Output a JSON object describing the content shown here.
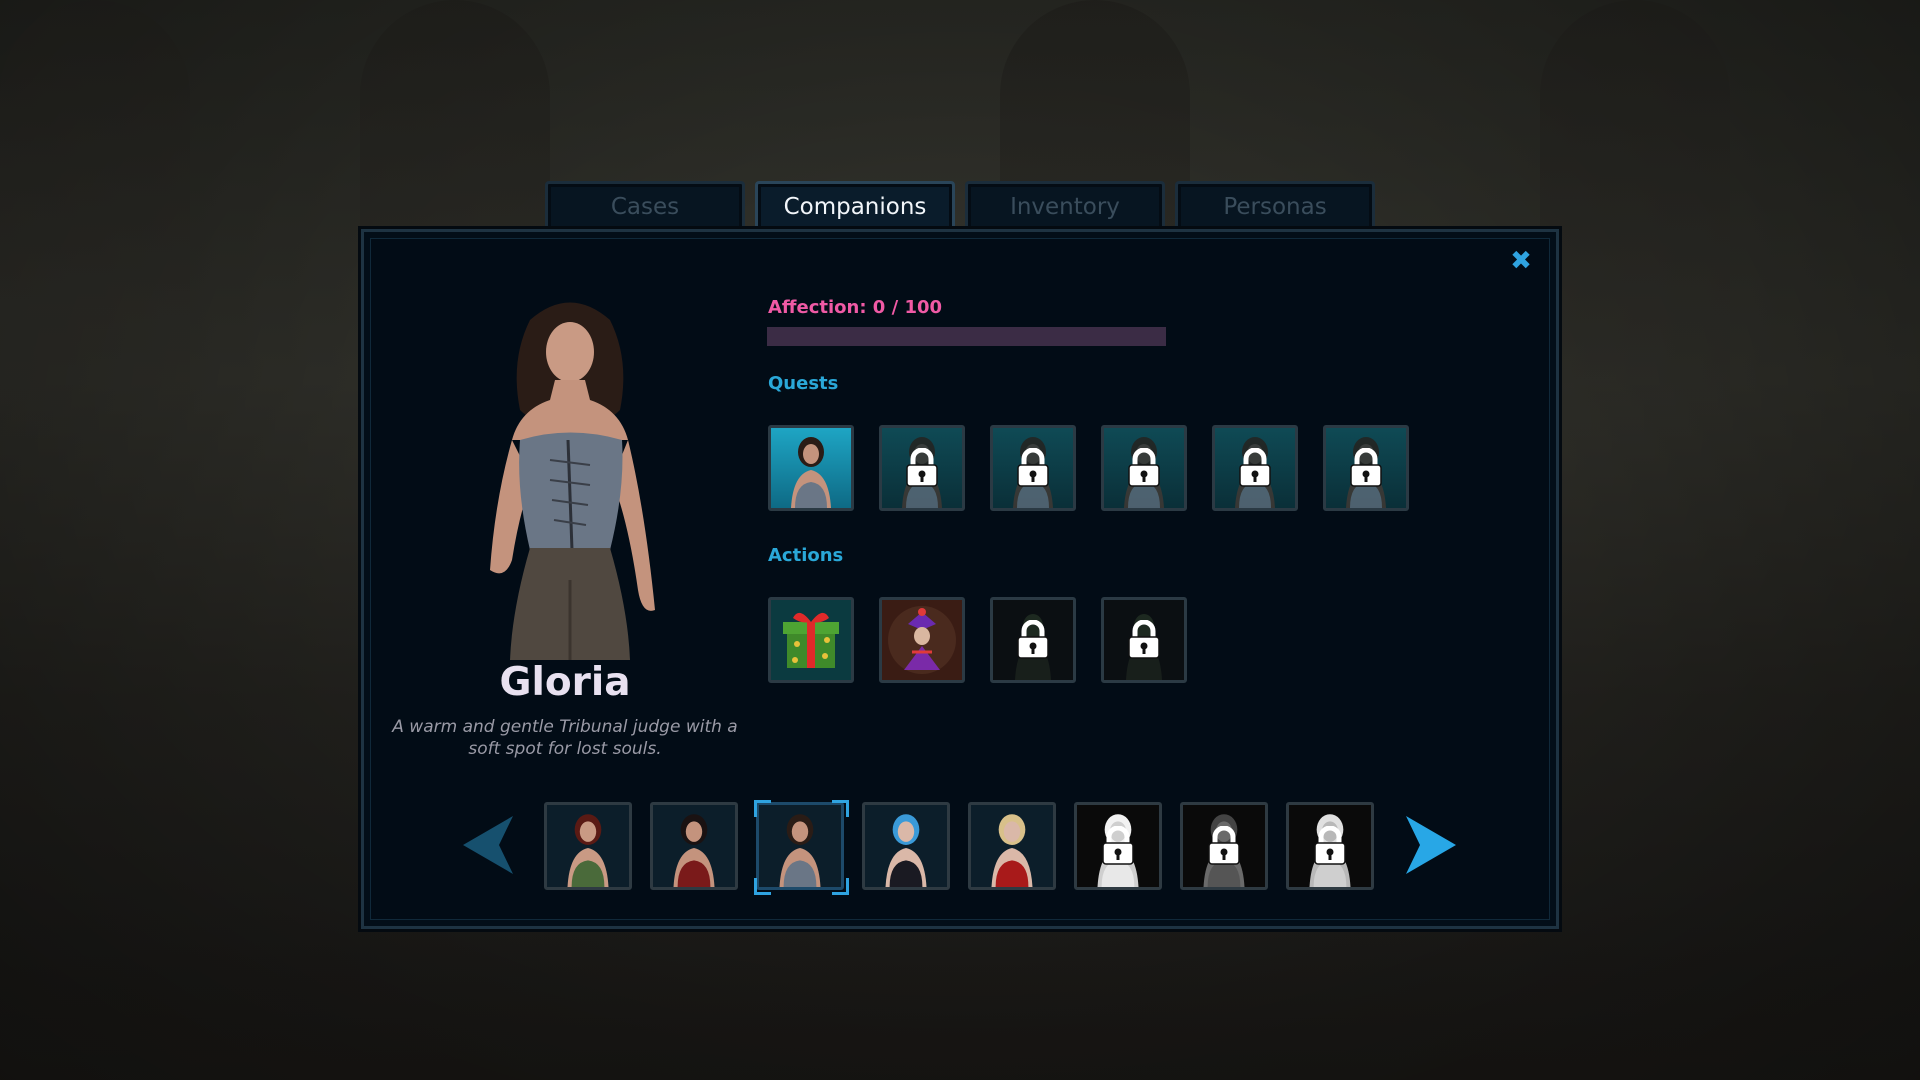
{
  "tabs": [
    {
      "label": "Cases",
      "active": false
    },
    {
      "label": "Companions",
      "active": true
    },
    {
      "label": "Inventory",
      "active": false
    },
    {
      "label": "Personas",
      "active": false
    }
  ],
  "close_icon": "close-icon",
  "character": {
    "name": "Gloria",
    "description": "A warm and gentle Tribunal judge with a soft spot for lost souls."
  },
  "affection": {
    "label": "Affection: 0 / 100",
    "value": 0,
    "max": 100,
    "color": "#f05aa5"
  },
  "quests": {
    "label": "Quests",
    "slots": [
      {
        "locked": false
      },
      {
        "locked": true
      },
      {
        "locked": true
      },
      {
        "locked": true
      },
      {
        "locked": true
      },
      {
        "locked": true
      }
    ]
  },
  "actions": {
    "label": "Actions",
    "slots": [
      {
        "name": "gift",
        "locked": false
      },
      {
        "name": "jester",
        "locked": false
      },
      {
        "name": "locked-action-1",
        "locked": true
      },
      {
        "name": "locked-action-2",
        "locked": true
      }
    ]
  },
  "companions": {
    "prev_icon": "arrow-left-icon",
    "next_icon": "arrow-right-icon",
    "selected_index": 2,
    "items": [
      {
        "locked": false
      },
      {
        "locked": false
      },
      {
        "locked": false
      },
      {
        "locked": false
      },
      {
        "locked": false
      },
      {
        "locked": true
      },
      {
        "locked": true
      },
      {
        "locked": true
      }
    ]
  },
  "colors": {
    "accent": "#2fa3e0",
    "section_label": "#2aa8d8",
    "panel_bg": "#020c16"
  }
}
